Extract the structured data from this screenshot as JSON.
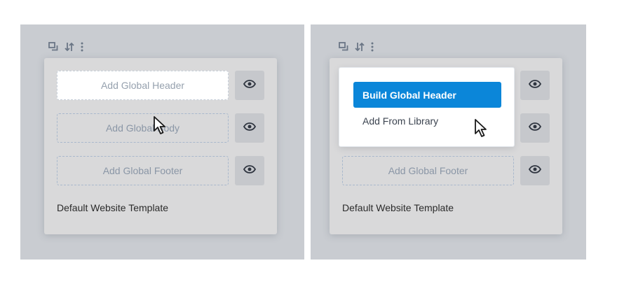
{
  "left_panel": {
    "slots": {
      "header": "Add Global Header",
      "body": "Add Global Body",
      "footer": "Add Global Footer"
    },
    "template_name": "Default Website Template"
  },
  "right_panel": {
    "menu": {
      "primary": "Build Global Header",
      "secondary": "Add From Library"
    },
    "slots": {
      "footer": "Add Global Footer"
    },
    "template_name": "Default Website Template"
  },
  "icons": {
    "toolbar": [
      "duplicate-icon",
      "sort-icon",
      "more-options-icon"
    ],
    "visibility": "eye-icon",
    "pointer": "mouse-pointer-icon"
  },
  "colors": {
    "panel_bg": "#c9ccd1",
    "card_bg": "#d9d9da",
    "accent": "#0b86d9",
    "icon": "#2f3540",
    "dashed_border": "#a8b8cc"
  }
}
